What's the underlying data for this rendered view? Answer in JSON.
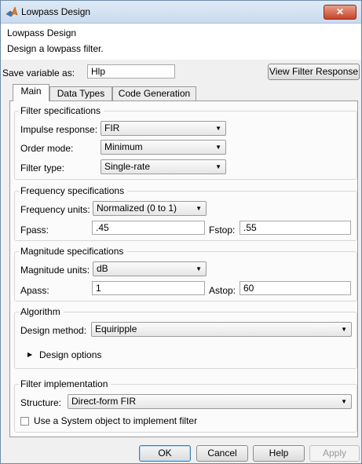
{
  "window": {
    "title": "Lowpass Design",
    "close_label": "✕"
  },
  "header": {
    "title": "Lowpass Design",
    "description": "Design a lowpass filter."
  },
  "save": {
    "label": "Save variable as:",
    "value": "Hlp",
    "view_button": "View Filter Response"
  },
  "tabs": [
    {
      "label": "Main"
    },
    {
      "label": "Data Types"
    },
    {
      "label": "Code Generation"
    }
  ],
  "filter_spec": {
    "title": "Filter specifications",
    "impulse_label": "Impulse response:",
    "impulse_value": "FIR",
    "order_label": "Order mode:",
    "order_value": "Minimum",
    "type_label": "Filter type:",
    "type_value": "Single-rate"
  },
  "freq_spec": {
    "title": "Frequency specifications",
    "units_label": "Frequency units:",
    "units_value": "Normalized (0 to 1)",
    "fpass_label": "Fpass:",
    "fpass_value": ".45",
    "fstop_label": "Fstop:",
    "fstop_value": ".55"
  },
  "mag_spec": {
    "title": "Magnitude specifications",
    "units_label": "Magnitude units:",
    "units_value": "dB",
    "apass_label": "Apass:",
    "apass_value": "1",
    "astop_label": "Astop:",
    "astop_value": "60"
  },
  "algorithm": {
    "title": "Algorithm",
    "method_label": "Design method:",
    "method_value": "Equiripple",
    "options_label": "Design options"
  },
  "implementation": {
    "title": "Filter implementation",
    "structure_label": "Structure:",
    "structure_value": "Direct-form FIR",
    "sysobj_label": "Use a System object to implement filter"
  },
  "buttons": {
    "ok": "OK",
    "cancel": "Cancel",
    "help": "Help",
    "apply": "Apply"
  },
  "icons": {
    "app": "matlab-icon",
    "dropdown": "chevron-down-icon",
    "expand": "triangle-right-icon"
  },
  "colors": {
    "title_bar": "#d4e2f2",
    "close_button": "#c7432a",
    "panel": "#f0f0f0",
    "field_bg": "#ffffff"
  }
}
